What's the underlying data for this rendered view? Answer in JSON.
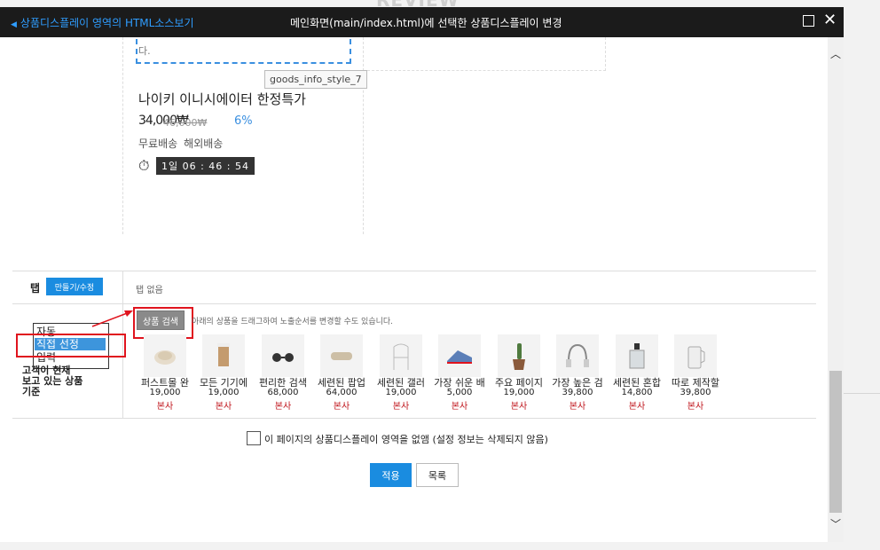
{
  "background": {
    "heading": "REVIEW"
  },
  "titlebar": {
    "left_link": "상품디스플레이 영역의 HTML소스보기",
    "title": "메인화면(main/index.html)에 선택한 상품디스플레이 변경"
  },
  "preview": {
    "box_text": "다.",
    "tooltip": "goods_info_style_7",
    "goods_name": "나이키 이니시에이터 한정특가",
    "price": "34,000₩",
    "original_price": "46,000₩",
    "discount_rate": "6%",
    "shipping": [
      "무료배송",
      "해외배송"
    ],
    "timer": "1일 06 : 46 : 54"
  },
  "tab_row": {
    "label": "탭",
    "edit_button": "만들기/수정",
    "value": "탭 없음"
  },
  "selection": {
    "options": [
      "자동",
      "직접 선정",
      "입력"
    ],
    "selected": "직접 선정",
    "criteria_label": [
      "고객이 현재",
      "보고 있는 상품",
      "기준"
    ],
    "search_button": "상품 검색",
    "hint": "아래의 상품을 드래그하여 노출순서를 변경할 수도 있습니다."
  },
  "products": [
    {
      "name": "퍼스트몰 완",
      "price": "19,000",
      "store": "본사",
      "icon": "bowl-icon"
    },
    {
      "name": "모든 기기에",
      "price": "19,000",
      "store": "본사",
      "icon": "cup-icon"
    },
    {
      "name": "편리한 검색",
      "price": "68,000",
      "store": "본사",
      "icon": "sunglasses-icon"
    },
    {
      "name": "세련된 팝업",
      "price": "64,000",
      "store": "본사",
      "icon": "roll-icon"
    },
    {
      "name": "세련된 갤러",
      "price": "19,000",
      "store": "본사",
      "icon": "chair-icon"
    },
    {
      "name": "가장 쉬운 배",
      "price": "5,000",
      "store": "본사",
      "icon": "sneaker-icon"
    },
    {
      "name": "주요 페이지",
      "price": "19,000",
      "store": "본사",
      "icon": "cactus-icon"
    },
    {
      "name": "가장 높은 검",
      "price": "39,800",
      "store": "본사",
      "icon": "headphones-icon"
    },
    {
      "name": "세련된 혼합",
      "price": "14,800",
      "store": "본사",
      "icon": "perfume-icon"
    },
    {
      "name": "따로 제작할",
      "price": "39,800",
      "store": "본사",
      "icon": "kettle-icon"
    }
  ],
  "footer": {
    "checkbox_label": "이 페이지의 상품디스플레이 영역을 없앰 (설정 정보는 삭제되지 않음)",
    "apply_button": "적용",
    "list_button": "목록"
  },
  "colors": {
    "accent": "#1a8ce0",
    "highlight_red": "#e0141e",
    "store_red": "#c0161c",
    "titlebar": "#1b1b1b"
  }
}
